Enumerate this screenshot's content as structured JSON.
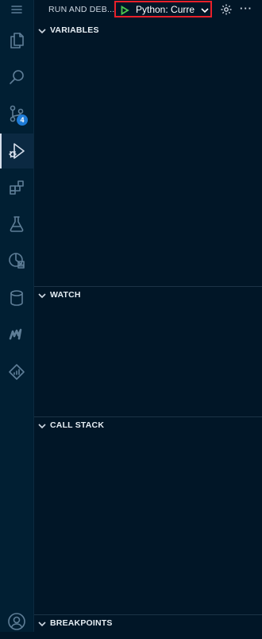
{
  "view": {
    "title": "RUN AND DEB...",
    "config_label": "Python: Curre",
    "accent_color": "#e8202a",
    "play_color": "#4ec94e"
  },
  "activity": {
    "items": [
      {
        "name": "menu-icon"
      },
      {
        "name": "explorer-icon"
      },
      {
        "name": "search-icon"
      },
      {
        "name": "source-control-icon",
        "badge": "4"
      },
      {
        "name": "run-debug-icon",
        "active": true
      },
      {
        "name": "extensions-icon"
      },
      {
        "name": "testing-icon"
      },
      {
        "name": "remote-explorer-icon"
      },
      {
        "name": "database-icon"
      },
      {
        "name": "m-logo-icon"
      },
      {
        "name": "diamond-chart-icon"
      },
      {
        "name": "account-icon"
      }
    ],
    "scm_badge": "4"
  },
  "sections": {
    "variables": "VARIABLES",
    "watch": "WATCH",
    "call_stack": "CALL STACK",
    "breakpoints": "BREAKPOINTS"
  }
}
